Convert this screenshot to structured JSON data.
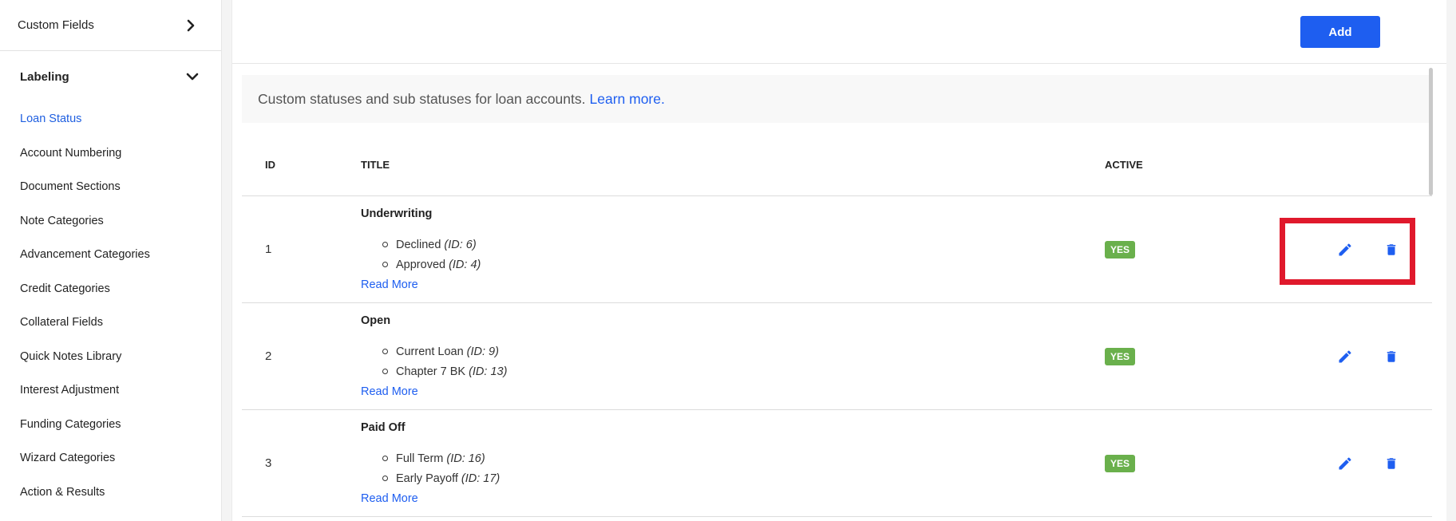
{
  "sidebar": {
    "custom_fields_label": "Custom Fields",
    "section_label": "Labeling",
    "items": [
      {
        "label": "Loan Status",
        "active": true
      },
      {
        "label": "Account Numbering"
      },
      {
        "label": "Document Sections"
      },
      {
        "label": "Note Categories"
      },
      {
        "label": "Advancement Categories"
      },
      {
        "label": "Credit Categories"
      },
      {
        "label": "Collateral Fields"
      },
      {
        "label": "Quick Notes Library"
      },
      {
        "label": "Interest Adjustment"
      },
      {
        "label": "Funding Categories"
      },
      {
        "label": "Wizard Categories"
      },
      {
        "label": "Action & Results"
      }
    ]
  },
  "toolbar": {
    "add_label": "Add"
  },
  "info": {
    "text": "Custom statuses and sub statuses for loan accounts.",
    "link_text": "Learn more."
  },
  "table": {
    "headers": {
      "id": "ID",
      "title": "TITLE",
      "active": "ACTIVE"
    },
    "rows": [
      {
        "id": "1",
        "title": "Underwriting",
        "subs": [
          {
            "name": "Declined",
            "sub_id": "(ID: 6)"
          },
          {
            "name": "Approved",
            "sub_id": "(ID: 4)"
          }
        ],
        "read_more": "Read More",
        "active": "YES"
      },
      {
        "id": "2",
        "title": "Open",
        "subs": [
          {
            "name": "Current Loan",
            "sub_id": "(ID: 9)"
          },
          {
            "name": "Chapter 7 BK",
            "sub_id": "(ID: 13)"
          }
        ],
        "read_more": "Read More",
        "active": "YES"
      },
      {
        "id": "3",
        "title": "Paid Off",
        "subs": [
          {
            "name": "Full Term",
            "sub_id": "(ID: 16)"
          },
          {
            "name": "Early Payoff",
            "sub_id": "(ID: 17)"
          }
        ],
        "read_more": "Read More",
        "active": "YES"
      }
    ]
  },
  "colors": {
    "accent": "#1e5ef0",
    "active_badge": "#6ab04c",
    "highlight": "#e0192c"
  }
}
